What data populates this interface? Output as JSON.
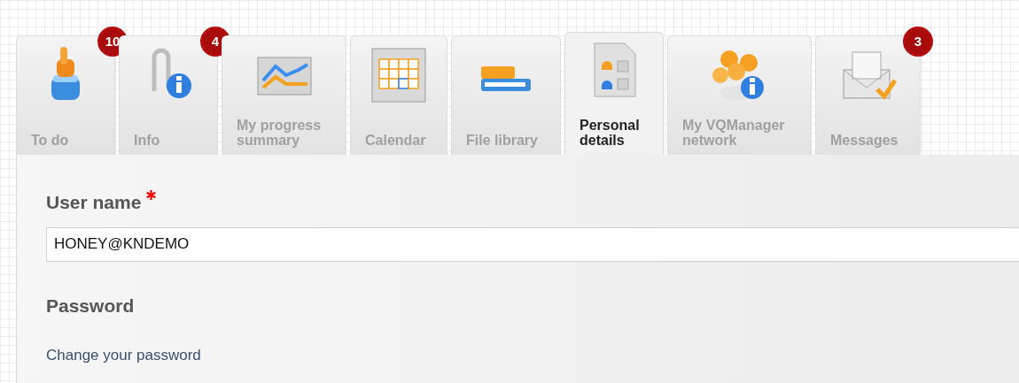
{
  "tabs": [
    {
      "label": "To do",
      "badge": "10",
      "selected": false
    },
    {
      "label": "Info",
      "badge": "4",
      "selected": false
    },
    {
      "label": "My progress summary",
      "selected": false
    },
    {
      "label": "Calendar",
      "selected": false
    },
    {
      "label": "File library",
      "selected": false
    },
    {
      "label": "Personal details",
      "selected": true
    },
    {
      "label": "My VQManager network",
      "selected": false
    },
    {
      "label": "Messages",
      "badge": "3",
      "selected": false
    }
  ],
  "form": {
    "user_name": {
      "label": "User name",
      "required": true,
      "value": "HONEY@KNDEMO"
    },
    "password": {
      "label": "Password",
      "link": "Change your password"
    }
  }
}
